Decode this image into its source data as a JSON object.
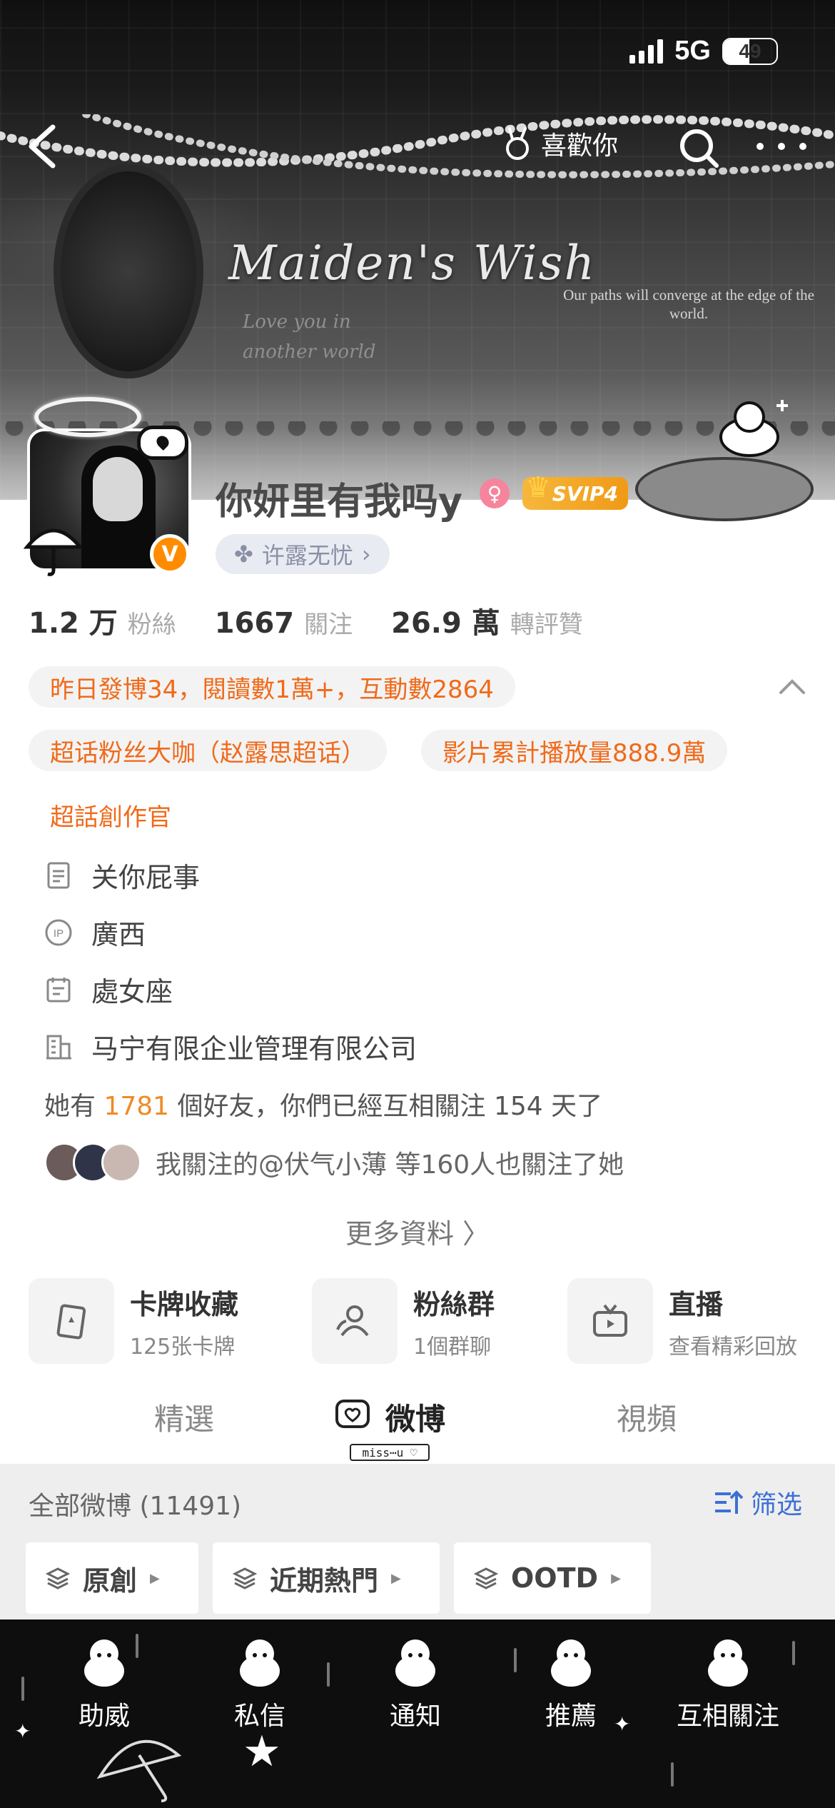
{
  "status_bar": {
    "network": "5G",
    "battery": "49",
    "battery_level": 0.49
  },
  "nav": {
    "like_label": "喜歡你"
  },
  "banner": {
    "title": "Maiden's Wish",
    "subtitle": "Our paths will converge at the edge of the world.",
    "love_line1": "Love you in",
    "love_line2": "another world"
  },
  "profile": {
    "username": "你妍里有我吗y",
    "gender_symbol": "♀",
    "vip_badge": "SVIP4",
    "verify_mark": "V",
    "tag": "许露无忧",
    "tag_arrow": "›"
  },
  "stats": [
    {
      "value": "1.2 万",
      "label": "粉絲"
    },
    {
      "value": "1667",
      "label": "關注"
    },
    {
      "value": "26.9 萬",
      "label": "轉評贊"
    }
  ],
  "highlights": {
    "yesterday": "昨日發博34，閱讀數1萬+，互動數2864",
    "chip1": "超话粉丝大咖（赵露思超话）",
    "chip2": "影片累計播放量888.9萬",
    "chip3": "超話創作官"
  },
  "info": {
    "bio": "关你屁事",
    "ip": "廣西",
    "zodiac": "處女座",
    "company": "马宁有限企业管理有限公司",
    "ip_icon_text": "IP"
  },
  "friends": {
    "prefix": "她有",
    "count": "1781",
    "suffix": "個好友，你們已經互相關注 154 天了"
  },
  "mutual": {
    "text": "我關注的@伏气小薄  等160人也關注了她"
  },
  "more_info": "更多資料 〉",
  "features": [
    {
      "title": "卡牌收藏",
      "sub": "125张卡牌",
      "icon": "card-icon"
    },
    {
      "title": "粉絲群",
      "sub": "1個群聊",
      "icon": "group-icon"
    },
    {
      "title": "直播",
      "sub": "查看精彩回放",
      "icon": "tv-icon"
    }
  ],
  "tabs": {
    "featured": "精選",
    "weibo": "微博",
    "video": "視頻",
    "badge": "miss⋯u ♡"
  },
  "feed": {
    "all_label": "全部微博 (11491)",
    "filter_label": "筛选",
    "segments": [
      "原創",
      "近期熱門",
      "OOTD"
    ]
  },
  "bottom_nav": [
    "助威",
    "私信",
    "通知",
    "推薦",
    "互相關注"
  ],
  "colors": {
    "accent_orange": "#f06a1a",
    "link_blue": "#3d6fd6",
    "vip_gold": "#f6b73c",
    "verify_orange": "#ff8c00"
  }
}
